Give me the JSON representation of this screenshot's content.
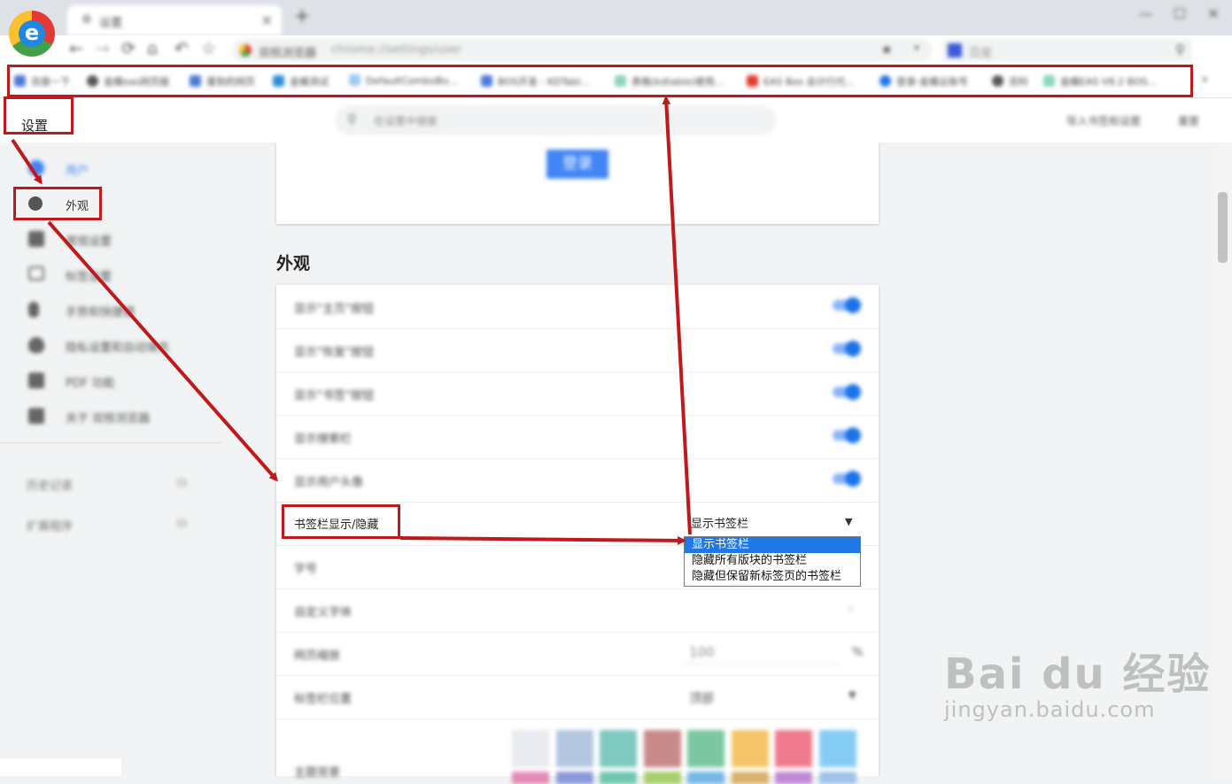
{
  "browser": {
    "tab": {
      "title": "设置"
    },
    "omnibox": {
      "site_label": "双核浏览器",
      "url": "chrome://settings/user"
    },
    "search_box": {
      "placeholder": "百度"
    }
  },
  "bookmarks_bar": {
    "items": [
      {
        "label": "百度一下"
      },
      {
        "label": "金蝶eas网页版"
      },
      {
        "label": "蓬勃的网页"
      },
      {
        "label": "金蝶测试"
      },
      {
        "label": "DefaultComboBo..."
      },
      {
        "label": "BOS开发 - KDTabl..."
      },
      {
        "label": "表格(kdtable)使用..."
      },
      {
        "label": "EAS Bos 会计行代..."
      },
      {
        "label": "登录-金蝶云账号"
      },
      {
        "label": "百科"
      },
      {
        "label": "金蝶EAS V8.2 BOS..."
      }
    ],
    "more": "»"
  },
  "settings": {
    "title": "设置",
    "search_placeholder": "在设置中搜索",
    "import_label": "导入书签和设置",
    "reset_label": "重置",
    "sidebar": {
      "items": [
        {
          "label": "用户",
          "icon": "user-icon"
        },
        {
          "label": "外观",
          "icon": "palette-icon"
        },
        {
          "label": "常规设置",
          "icon": "wrench-icon"
        },
        {
          "label": "标签设置",
          "icon": "tab-icon"
        },
        {
          "label": "手势和快捷键",
          "icon": "mouse-icon"
        },
        {
          "label": "隐私设置和自动填充",
          "icon": "shield-icon"
        },
        {
          "label": "PDF 功能",
          "icon": "pdf-icon"
        },
        {
          "label": "关于 双核浏览器",
          "icon": "info-icon"
        }
      ],
      "links": [
        {
          "label": "历史记录"
        },
        {
          "label": "扩展程序"
        }
      ]
    },
    "account": {
      "login_label": "登录"
    },
    "appearance": {
      "section_title": "外观",
      "toggles": [
        {
          "label": "显示\"主页\"按钮",
          "on": true
        },
        {
          "label": "显示\"恢复\"按钮",
          "on": true
        },
        {
          "label": "显示\"书签\"按钮",
          "on": true
        },
        {
          "label": "显示搜索栏",
          "on": true
        },
        {
          "label": "显示用户头像",
          "on": true
        }
      ],
      "bookmark_bar": {
        "label": "书签栏显示/隐藏",
        "value": "显示书签栏",
        "options": [
          "显示书签栏",
          "隐藏所有版块的书签栏",
          "隐藏但保留新标签页的书签栏"
        ],
        "selected_index": 0
      },
      "font_size_label": "字号",
      "custom_font_label": "自定义字体",
      "zoom": {
        "label": "网页缩放",
        "value": "100",
        "unit": "%"
      },
      "tab_position": {
        "label": "标签栏位置",
        "value": "顶部"
      },
      "theme": {
        "label": "主题背景",
        "swatches": [
          "#e8eaf0",
          "#b3c6e0",
          "#7ec9c0",
          "#c98a8a",
          "#7cc7a3",
          "#f5c56a",
          "#ef7a8e",
          "#86cdf5"
        ],
        "swatches_row2": [
          "#e58ab8",
          "#8a9ad8",
          "#6fc6b0",
          "#a7d06b",
          "#74b8e8",
          "#d9b26c",
          "#c28ad4",
          "#9ec3e8"
        ]
      }
    }
  },
  "colors": {
    "annotation": "#c0191c",
    "accent": "#1a73e8",
    "selected_option": "#1e78e6"
  },
  "watermark": {
    "main": "Bai du 经验",
    "sub": "jingyan.baidu.com"
  }
}
